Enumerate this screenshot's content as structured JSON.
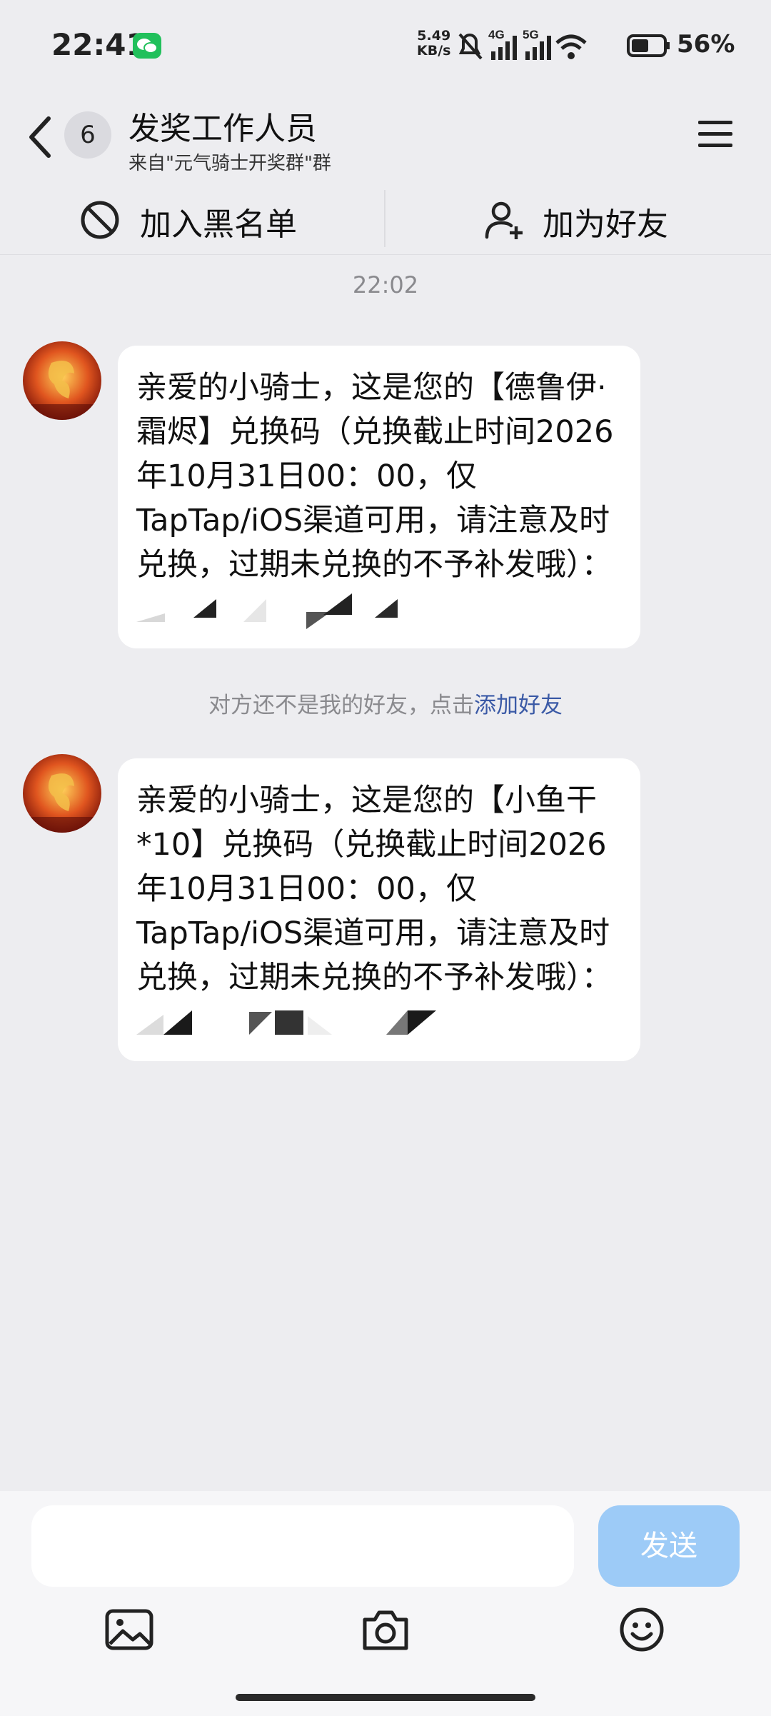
{
  "status_bar": {
    "time": "22:41",
    "speed_value": "5.49",
    "speed_unit": "KB/s",
    "net1": "4G",
    "net2": "5G",
    "battery": "56%",
    "icons": [
      "wechat-icon",
      "mute-bell-icon",
      "signal-icon",
      "signal-icon",
      "wifi-icon",
      "battery-icon"
    ]
  },
  "header": {
    "unread_count": "6",
    "title": "发奖工作人员",
    "subtitle": "来自\"元气骑士开奖群\"群"
  },
  "actions": {
    "block_label": "加入黑名单",
    "add_friend_label": "加为好友"
  },
  "chat": {
    "timestamp": "22:02",
    "messages": [
      {
        "text": "亲爱的小骑士，这是您的【德鲁伊·霜烬】兑换码（兑换截止时间2026年10月31日00：00，仅TapTap/iOS渠道可用，请注意及时兑换，过期未兑换的不予补发哦）："
      },
      {
        "text": "亲爱的小骑士，这是您的【小鱼干*10】兑换码（兑换截止时间2026年10月31日00：00，仅TapTap/iOS渠道可用，请注意及时兑换，过期未兑换的不予补发哦）："
      }
    ],
    "system_tip": "对方还不是我的好友，点击",
    "system_tip_link": "添加好友"
  },
  "composer": {
    "send_label": "发送"
  },
  "colors": {
    "background": "#ededf0",
    "send_button": "#9dcbf7",
    "link": "#3b5aa6"
  }
}
